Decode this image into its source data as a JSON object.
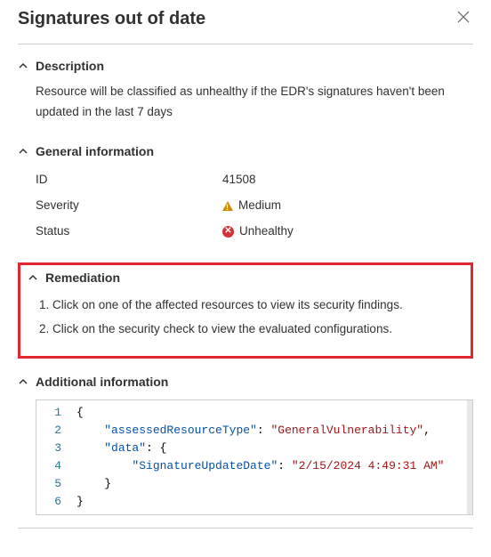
{
  "header": {
    "title": "Signatures out of date"
  },
  "description": {
    "heading": "Description",
    "text": "Resource will be classified as unhealthy if the EDR's signatures haven't been updated in the last 7 days"
  },
  "general": {
    "heading": "General information",
    "id_label": "ID",
    "id_value": "41508",
    "severity_label": "Severity",
    "severity_value": "Medium",
    "status_label": "Status",
    "status_value": "Unhealthy"
  },
  "remediation": {
    "heading": "Remediation",
    "step1": "Click on one of the affected resources to view its security findings.",
    "step2": "Click on the security check to view the evaluated configurations."
  },
  "additional": {
    "heading": "Additional information",
    "json": {
      "key1": "\"assessedResourceType\"",
      "val1": "\"GeneralVulnerability\"",
      "key2": "\"data\"",
      "key3": "\"SignatureUpdateDate\"",
      "val3": "\"2/15/2024 4:49:31 AM\""
    },
    "line_numbers": {
      "l1": "1",
      "l2": "2",
      "l3": "3",
      "l4": "4",
      "l5": "5",
      "l6": "6"
    }
  }
}
